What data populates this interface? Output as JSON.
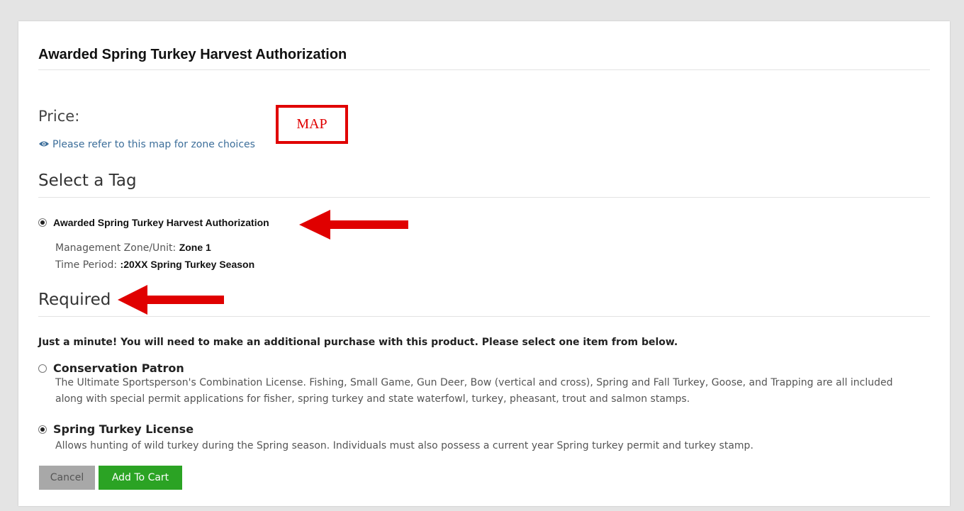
{
  "page": {
    "title": "Awarded Spring Turkey Harvest Authorization",
    "price_label": "Price:",
    "map_link": "Please refer to this map for zone choices",
    "map_annotation": "MAP"
  },
  "select_tag": {
    "heading": "Select a Tag",
    "option_label": "Awarded Spring Turkey Harvest Authorization",
    "zone_label": "Management Zone/Unit: ",
    "zone_value": "Zone 1",
    "period_label": "Time Period: ",
    "period_value": ":20XX Spring Turkey Season"
  },
  "required": {
    "heading": "Required",
    "notice": "Just a minute!  You will need to make an additional purchase with this product.  Please select one item from below.",
    "options": [
      {
        "label": "Conservation Patron",
        "description": "The Ultimate Sportsperson's Combination License. Fishing, Small Game, Gun Deer, Bow (vertical and cross), Spring and Fall Turkey, Goose, and Trapping are all included along with special permit applications for fisher, spring turkey and state waterfowl, turkey, pheasant, trout and salmon stamps.",
        "selected": false
      },
      {
        "label": "Spring Turkey License",
        "description": "Allows hunting of wild turkey during the  Spring season. Individuals must also possess a current year  Spring  turkey permit and turkey stamp.",
        "selected": true
      }
    ]
  },
  "actions": {
    "cancel": "Cancel",
    "add_to_cart": "Add To Cart"
  },
  "colors": {
    "annotation_red": "#e00000",
    "add_button_green": "#2ba324",
    "cancel_button_gray": "#a8a8a8",
    "link_blue": "#3c6e9a"
  },
  "icons": {
    "map_link_icon": "eye-icon",
    "annotation_arrow": "left-arrow-icon"
  }
}
